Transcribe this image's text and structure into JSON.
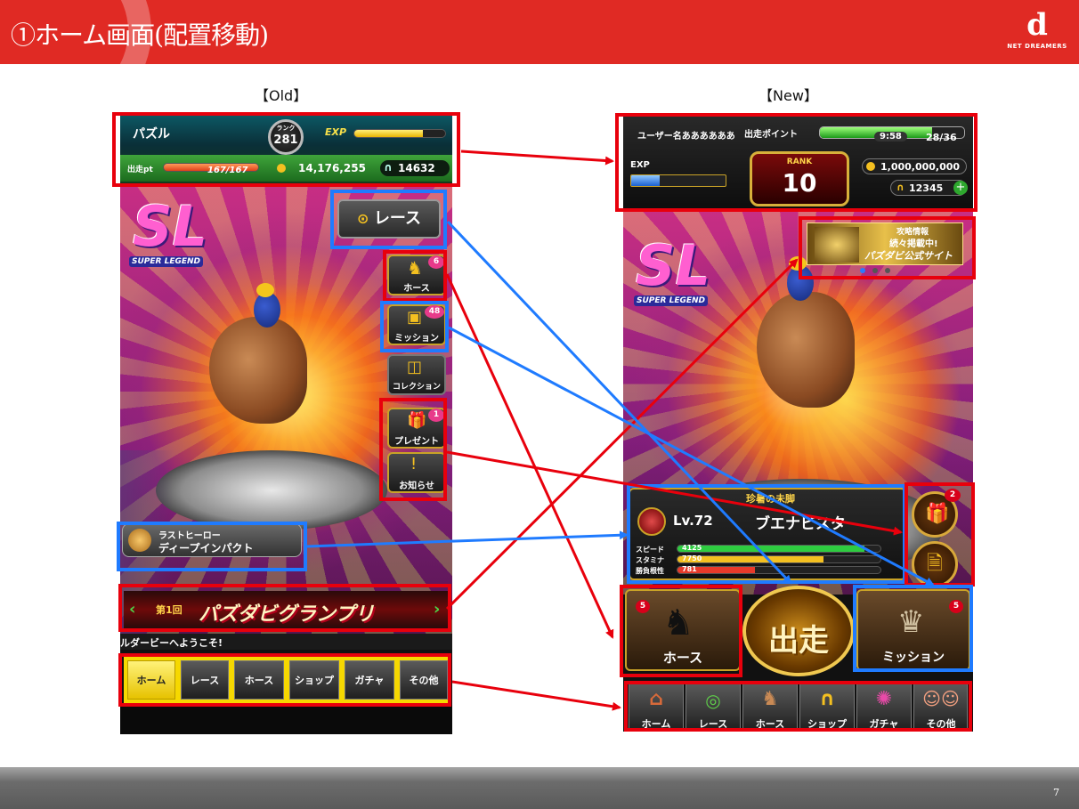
{
  "slide": {
    "title": "①ホーム画面(配置移動)",
    "logo_mark": "d",
    "logo_text": "NET DREAMERS",
    "page_number": "7",
    "colors": {
      "header": "#e02a24",
      "annotation_red": "#e8000c",
      "annotation_blue": "#1f7bff"
    }
  },
  "old": {
    "label": "【Old】",
    "status": {
      "player_name": "パズル",
      "rank_label": "ランク",
      "rank": "281",
      "exp_label": "EXP",
      "exp_fill": 0.75,
      "pt_label": "出走pt",
      "pt_value": "167/167",
      "coins": "14,176,255",
      "tickets": "14632"
    },
    "race_button": "レース",
    "side_buttons": [
      {
        "label": "ホース",
        "badge": "6",
        "icon": "horse-icon"
      },
      {
        "label": "ミッション",
        "badge": "48",
        "icon": "mission-icon"
      },
      {
        "label": "コレクション",
        "badge": "",
        "icon": "collection-icon"
      },
      {
        "label": "プレゼント",
        "badge": "1",
        "icon": "present-icon"
      },
      {
        "label": "お知らせ",
        "badge": "",
        "icon": "notice-icon"
      }
    ],
    "horse_plate": {
      "line1": "ラストヒーロー",
      "line2": "ディープインパクト"
    },
    "banner": "パズダビグランプリ",
    "banner_tag": "第1回",
    "ticker": "ルダービーへようこそ!",
    "tabs": [
      "ホーム",
      "レース",
      "ホース",
      "ショップ",
      "ガチャ",
      "その他"
    ]
  },
  "new": {
    "label": "【New】",
    "status": {
      "username": "ユーザー名ああああああ",
      "pt_label": "出走ポイント",
      "pt_fill": 0.78,
      "timer": "9:58",
      "pt_value": "28/36",
      "exp_label": "EXP",
      "exp_fill": 0.3,
      "rank_label": "RANK",
      "rank": "10",
      "coins": "1,000,000,000",
      "tickets": "12345"
    },
    "banner": {
      "line1": "攻略情報",
      "line2": "続々掲載中!",
      "line3": "パズダビ公式サイト",
      "dots": 3
    },
    "horse_card": {
      "title": "珍暑の未脚",
      "level": "Lv.72",
      "name": "ブエナビスタ",
      "stats": [
        {
          "label": "スピード",
          "value": "4125",
          "fill": 0.92
        },
        {
          "label": "スタミナ",
          "value": "7750",
          "fill": 0.72
        },
        {
          "label": "勝負根性",
          "value": "781",
          "fill": 0.38
        }
      ]
    },
    "present_badge": "2",
    "horse_button": {
      "label": "ホース",
      "badge": "5"
    },
    "start_button": "出走",
    "mission_button": {
      "label": "ミッション",
      "badge": "5"
    },
    "tabs": [
      {
        "label": "ホーム",
        "icon": "house-icon"
      },
      {
        "label": "レース",
        "icon": "racetrack-icon"
      },
      {
        "label": "ホース",
        "icon": "horse-icon"
      },
      {
        "label": "ショップ",
        "icon": "horseshoe-icon"
      },
      {
        "label": "ガチャ",
        "icon": "gacha-icon"
      },
      {
        "label": "その他",
        "icon": "other-icon"
      }
    ]
  },
  "shared": {
    "game_logo": "SL",
    "game_logo_sub": "SUPER LEGEND"
  }
}
